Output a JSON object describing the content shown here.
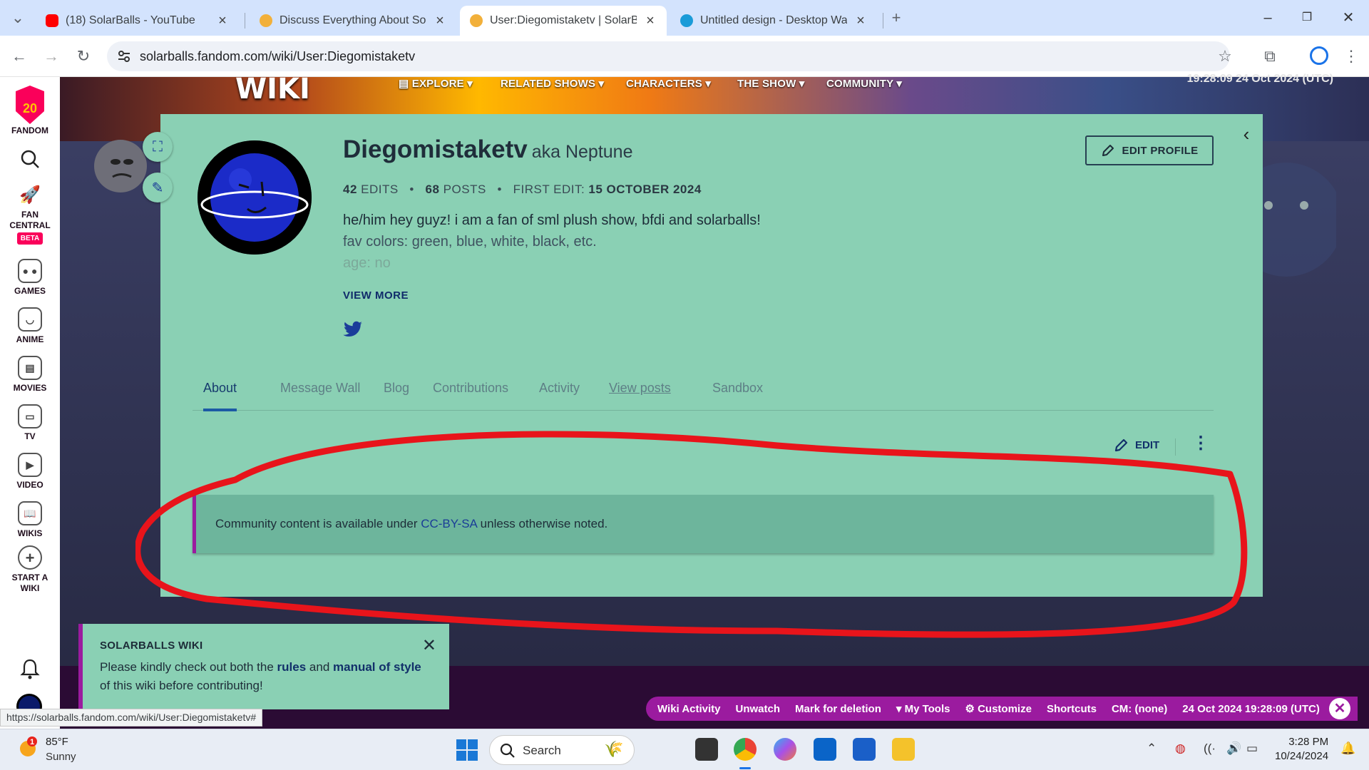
{
  "browser": {
    "tabs": [
      {
        "title": "(18) SolarBalls - YouTube",
        "favicon_color": "#ff0000"
      },
      {
        "title": "Discuss Everything About Solar",
        "favicon_color": "#f2b03a"
      },
      {
        "title": "User:Diegomistaketv | SolarBall",
        "favicon_color": "#f2b03a",
        "active": true
      },
      {
        "title": "Untitled design - Desktop Wall",
        "favicon_color": "#1a9bd8"
      }
    ],
    "close_glyph": "×",
    "new_tab_glyph": "+",
    "url": "solarballs.fandom.com/wiki/User:Diegomistaketv",
    "status_url": "https://solarballs.fandom.com/wiki/User:Diegomistaketv#"
  },
  "rail": {
    "logo_number": "20",
    "fandom": "FANDOM",
    "items": [
      {
        "label": "FAN",
        "label2": "CENTRAL",
        "badge": "BETA",
        "icon": "rocket-icon"
      },
      {
        "label": "GAMES",
        "icon": "gamepad-icon"
      },
      {
        "label": "ANIME",
        "icon": "anime-face-icon"
      },
      {
        "label": "MOVIES",
        "icon": "clapperboard-icon"
      },
      {
        "label": "TV",
        "icon": "tv-icon"
      },
      {
        "label": "VIDEO",
        "icon": "play-icon"
      },
      {
        "label": "WIKIS",
        "icon": "book-icon"
      },
      {
        "label": "START A",
        "label2": "WIKI",
        "icon": "plus-circle-icon"
      }
    ]
  },
  "wiki_header": {
    "logo": "WIKI",
    "nav": [
      "EXPLORE",
      "RELATED SHOWS",
      "CHARACTERS",
      "THE SHOW",
      "COMMUNITY"
    ],
    "clock": "19:28:09 24 Oct 2024 (UTC)"
  },
  "profile": {
    "username": "Diegomistaketv",
    "aka": "aka Neptune",
    "edits_count": "42",
    "edits_label": "EDITS",
    "posts_count": "68",
    "posts_label": "POSTS",
    "first_edit_label": "FIRST EDIT:",
    "first_edit_date": "15 OCTOBER 2024",
    "bio": [
      "he/him hey guyz! i am a fan of sml plush show, bfdi and solarballs!",
      "fav colors: green, blue, white, black, etc.",
      "age: no"
    ],
    "view_more": "VIEW MORE",
    "edit_profile": "EDIT PROFILE",
    "tabs": [
      "About",
      "Message Wall",
      "Blog",
      "Contributions",
      "Activity",
      "View posts",
      "Sandbox"
    ],
    "edit_label": "EDIT",
    "license_prefix": "Community content is available under ",
    "license_link": "CC-BY-SA",
    "license_suffix": " unless otherwise noted.",
    "annotation_color": "#e8141b"
  },
  "notice": {
    "title": "SOLARBALLS WIKI",
    "text_1": "Please kindly check out both the ",
    "link_rules": "rules",
    "text_2": " and ",
    "link_manual": "manual of style",
    "text_3": "of this wiki before contributing!"
  },
  "bottom_toolbar": [
    "Wiki Activity",
    "Unwatch",
    "Mark for deletion",
    "▾ My Tools",
    "⚙ Customize",
    "Shortcuts",
    "CM: (none)",
    "24 Oct 2024 19:28:09 (UTC)"
  ],
  "taskbar": {
    "weather_badge": "1",
    "temp": "85°F",
    "condition": "Sunny",
    "search": "Search",
    "time": "3:28 PM",
    "date": "10/24/2024"
  },
  "colors": {
    "card": "#8ad0b4",
    "accent": "#9b1b9f",
    "link": "#1a3c97"
  }
}
